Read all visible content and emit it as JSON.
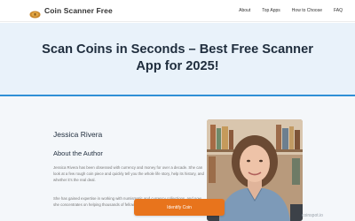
{
  "header": {
    "brand": "Coin Scanner Free",
    "nav": [
      "About",
      "Top Apps",
      "How to Choose",
      "FAQ"
    ]
  },
  "hero": {
    "title": "Scan Coins in Seconds – Best Free Scanner App for 2025!"
  },
  "author": {
    "name": "Jessica Rivera",
    "heading": "About the Author",
    "bio_1": "Jessica Rivera has been obsessed with currency and money for over a decade. She can look at a few rough coin piece and quickly tell you the whole life story, help its history, and whether it's the real deal.",
    "bio_2": "She has gained expertise in working with numismatic and currency collections, and now she concentrates on helping thousands of fellow collectors."
  },
  "cta": {
    "label": "Identify Coin"
  },
  "watermark": "coinspot.io",
  "colors": {
    "accent": "#2f8fd6",
    "cta": "#e8741c",
    "hero_bg": "#e9f2fa"
  }
}
